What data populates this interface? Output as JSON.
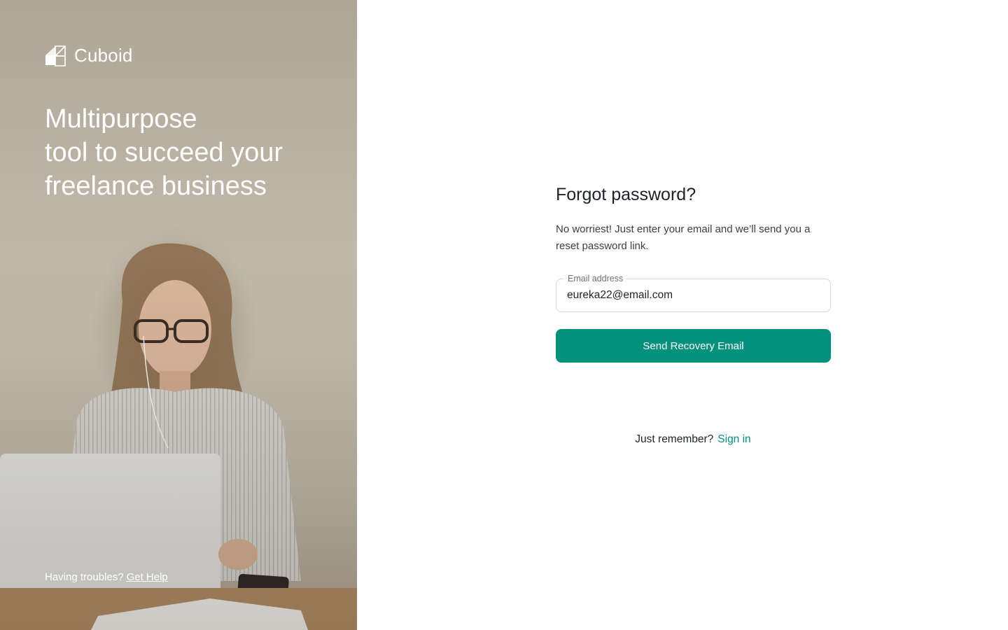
{
  "brand": {
    "name": "Cuboid",
    "icon": "cube-logo-icon"
  },
  "hero": {
    "headline_lines": [
      "Multipurpose",
      "tool to succeed your",
      "freelance business"
    ],
    "help_text": "Having troubles?",
    "help_link": "Get Help"
  },
  "form": {
    "title": "Forgot password?",
    "description": "No worriest! Just enter your email and we’ll send you a reset password link.",
    "email_label": "Email address",
    "email_value": "eureka22@email.com",
    "submit_label": "Send Recovery Email"
  },
  "footer": {
    "question": "Just remember?",
    "signin_link": "Sign in"
  },
  "colors": {
    "accent": "#02917c",
    "text": "#1f2328",
    "muted": "#6b7178"
  }
}
